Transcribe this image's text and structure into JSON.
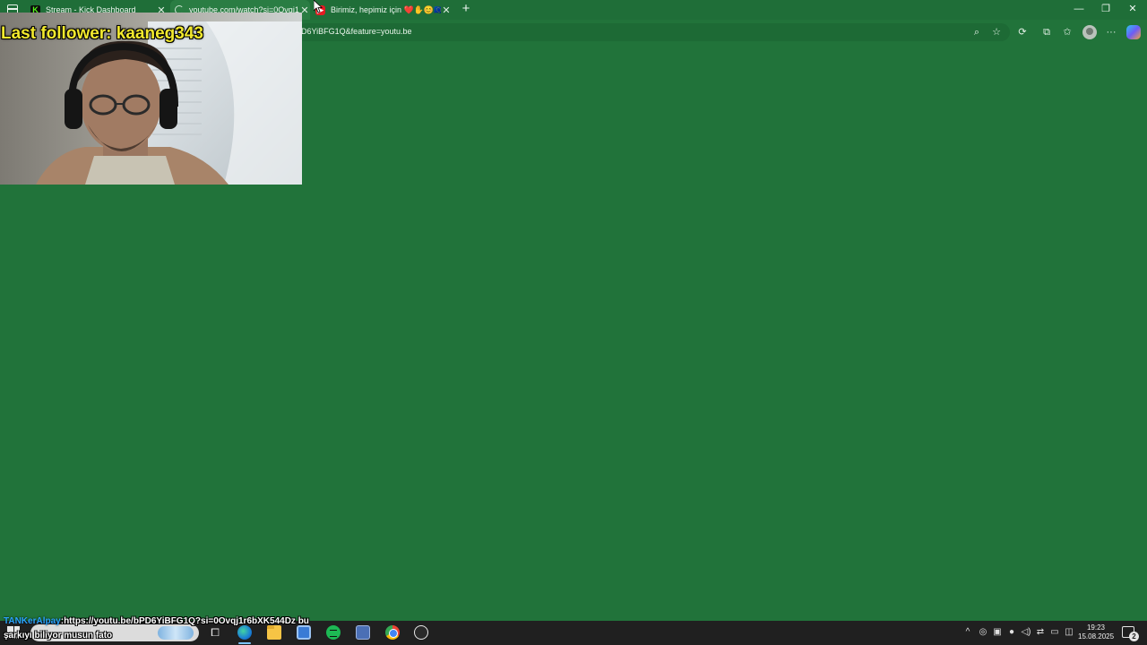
{
  "browser": {
    "tabs": [
      {
        "title": "Stream - Kick Dashboard",
        "favicon": "kick-icon"
      },
      {
        "title": "youtube.com/watch?si=0Ovqj1r6",
        "favicon": "loading-icon",
        "active": true
      },
      {
        "title": "Birimiz, hepimiz için ❤️✋😊🇪🇺",
        "favicon": "youtube-icon"
      }
    ],
    "address_text": "D6YiBFG1Q&feature=youtu.be",
    "page_background": "#21733a"
  },
  "overlay": {
    "last_follower": "Last follower: kaaneg343"
  },
  "chat": {
    "username": "TANKerAlpay",
    "separator": ":",
    "message_line1": "https://youtu.be/bPD6YiBFG1Q?si=0Ovqj1r6bXK544Dz bu",
    "message_line2": "şarkıyı biliyor musun fato"
  },
  "taskbar": {
    "time": "19:23",
    "date": "15.08.2025",
    "notification_count": "2"
  }
}
